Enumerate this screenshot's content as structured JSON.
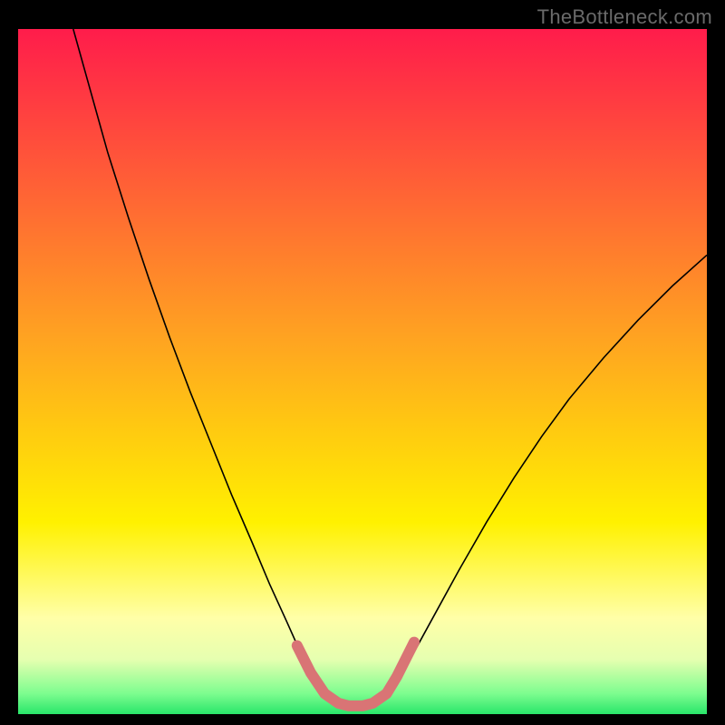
{
  "watermark": "TheBottleneck.com",
  "chart_data": {
    "type": "line",
    "title": "",
    "xlabel": "",
    "ylabel": "",
    "xlim": [
      0,
      100
    ],
    "ylim": [
      0,
      100
    ],
    "grid": false,
    "legend": false,
    "gradient_stops": [
      {
        "offset": 0.0,
        "color": "#ff1c4b"
      },
      {
        "offset": 0.45,
        "color": "#ffa321"
      },
      {
        "offset": 0.72,
        "color": "#fff100"
      },
      {
        "offset": 0.86,
        "color": "#ffffa8"
      },
      {
        "offset": 0.92,
        "color": "#e6ffb0"
      },
      {
        "offset": 0.97,
        "color": "#7dfd8f"
      },
      {
        "offset": 1.0,
        "color": "#29e56a"
      }
    ],
    "series": [
      {
        "name": "bottleneck-curve",
        "color": "#000000",
        "width": 1.6,
        "points": [
          {
            "x": 8.0,
            "y": 100.0
          },
          {
            "x": 10.5,
            "y": 91.0
          },
          {
            "x": 13.0,
            "y": 82.0
          },
          {
            "x": 16.0,
            "y": 72.5
          },
          {
            "x": 19.0,
            "y": 63.5
          },
          {
            "x": 22.0,
            "y": 55.0
          },
          {
            "x": 25.0,
            "y": 47.0
          },
          {
            "x": 28.0,
            "y": 39.5
          },
          {
            "x": 31.0,
            "y": 32.0
          },
          {
            "x": 34.0,
            "y": 25.0
          },
          {
            "x": 36.5,
            "y": 19.0
          },
          {
            "x": 39.0,
            "y": 13.5
          },
          {
            "x": 41.0,
            "y": 9.0
          },
          {
            "x": 43.0,
            "y": 5.5
          },
          {
            "x": 45.0,
            "y": 3.0
          },
          {
            "x": 47.0,
            "y": 1.5
          },
          {
            "x": 49.0,
            "y": 1.0
          },
          {
            "x": 51.0,
            "y": 1.5
          },
          {
            "x": 53.0,
            "y": 3.0
          },
          {
            "x": 55.0,
            "y": 5.5
          },
          {
            "x": 58.0,
            "y": 10.0
          },
          {
            "x": 61.0,
            "y": 15.5
          },
          {
            "x": 64.0,
            "y": 21.0
          },
          {
            "x": 68.0,
            "y": 28.0
          },
          {
            "x": 72.0,
            "y": 34.5
          },
          {
            "x": 76.0,
            "y": 40.5
          },
          {
            "x": 80.0,
            "y": 46.0
          },
          {
            "x": 85.0,
            "y": 52.0
          },
          {
            "x": 90.0,
            "y": 57.5
          },
          {
            "x": 95.0,
            "y": 62.5
          },
          {
            "x": 100.0,
            "y": 67.0
          }
        ]
      },
      {
        "name": "optimal-basin",
        "color": "#d97475",
        "width": 12,
        "linecap": "round",
        "points": [
          {
            "x": 40.5,
            "y": 10.0
          },
          {
            "x": 42.5,
            "y": 6.0
          },
          {
            "x": 44.5,
            "y": 3.0
          },
          {
            "x": 46.5,
            "y": 1.6
          },
          {
            "x": 48.0,
            "y": 1.2
          },
          {
            "x": 50.0,
            "y": 1.2
          },
          {
            "x": 51.5,
            "y": 1.6
          },
          {
            "x": 53.5,
            "y": 3.0
          },
          {
            "x": 55.0,
            "y": 5.5
          },
          {
            "x": 56.5,
            "y": 8.5
          },
          {
            "x": 57.5,
            "y": 10.5
          }
        ]
      }
    ]
  }
}
